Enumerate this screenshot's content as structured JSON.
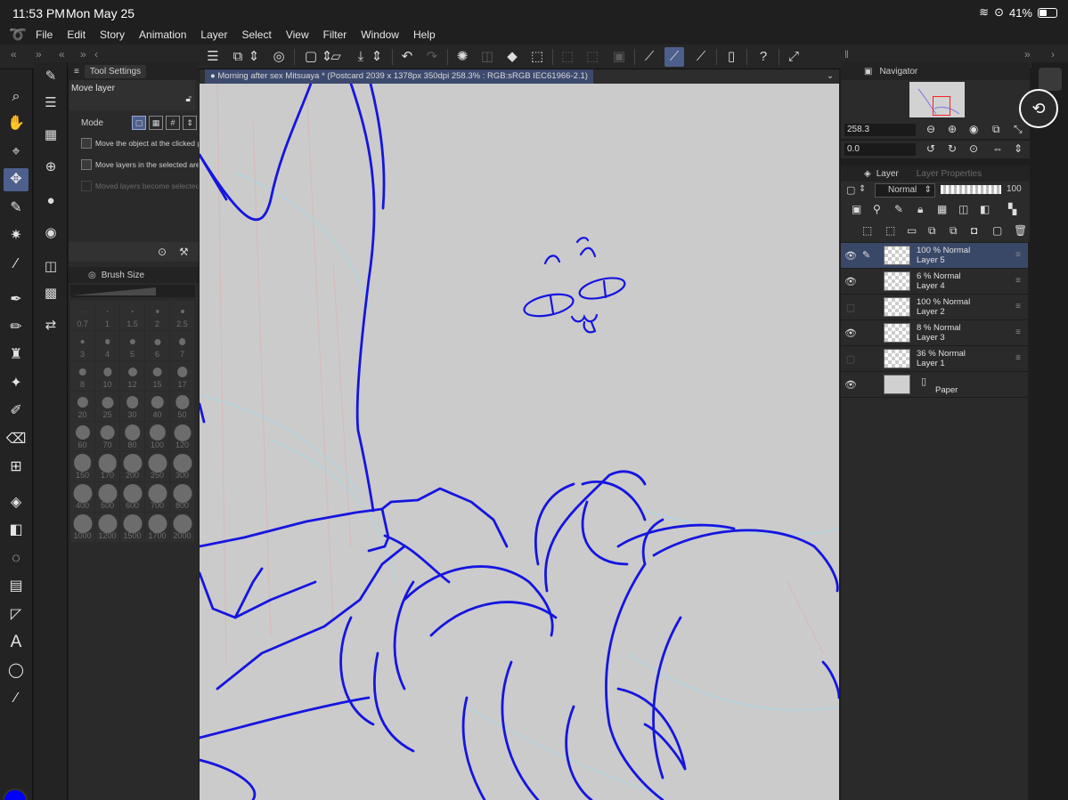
{
  "status": {
    "time": "11:53 PM",
    "date": "Mon May 25",
    "battery": "41%"
  },
  "menu": [
    "File",
    "Edit",
    "Story",
    "Animation",
    "Layer",
    "Select",
    "View",
    "Filter",
    "Window",
    "Help"
  ],
  "tool_settings": {
    "tab": "Tool Settings",
    "title": "Move layer",
    "mode_label": "Mode",
    "options": [
      {
        "label": "Move the object at the clicked pos",
        "enabled": true
      },
      {
        "label": "Move layers in the selected area",
        "enabled": true
      },
      {
        "label": "Moved layers become selected",
        "enabled": false
      }
    ]
  },
  "brush_size": {
    "tab": "Brush Size",
    "sizes": [
      "0.7",
      "1",
      "1.5",
      "2",
      "2.5",
      "3",
      "4",
      "5",
      "6",
      "7",
      "8",
      "10",
      "12",
      "15",
      "17",
      "20",
      "25",
      "30",
      "40",
      "50",
      "60",
      "70",
      "80",
      "100",
      "120",
      "150",
      "170",
      "200",
      "250",
      "300",
      "400",
      "500",
      "600",
      "700",
      "800",
      "1000",
      "1200",
      "1500",
      "1700",
      "2000"
    ]
  },
  "document": {
    "title": "Morning after sex Mitsuaya * (Postcard 2039 x 1378px 350dpi 258.3% : RGB:sRGB IEC61966-2.1)"
  },
  "navigator": {
    "tab": "Navigator",
    "zoom": "258.3",
    "rotation": "0.0"
  },
  "layer_panel": {
    "tab": "Layer",
    "tab2": "Layer Properties",
    "blend": "Normal",
    "opacity": "100",
    "layers": [
      {
        "opacity": "100 %",
        "mode": "Normal",
        "name": "Layer 5",
        "visible": true,
        "selected": true
      },
      {
        "opacity": "6 %",
        "mode": "Normal",
        "name": "Layer 4",
        "visible": true,
        "selected": false
      },
      {
        "opacity": "100 %",
        "mode": "Normal",
        "name": "Layer 2",
        "visible": false,
        "selected": false
      },
      {
        "opacity": "8 %",
        "mode": "Normal",
        "name": "Layer 3",
        "visible": true,
        "selected": false
      },
      {
        "opacity": "36 %",
        "mode": "Normal",
        "name": "Layer 1",
        "visible": false,
        "selected": false
      },
      {
        "opacity": "",
        "mode": "",
        "name": "Paper",
        "visible": true,
        "selected": false
      }
    ]
  },
  "colors": {
    "main": "#0000ff",
    "sub": "#ffffff",
    "accent": "#4d5f8c"
  }
}
